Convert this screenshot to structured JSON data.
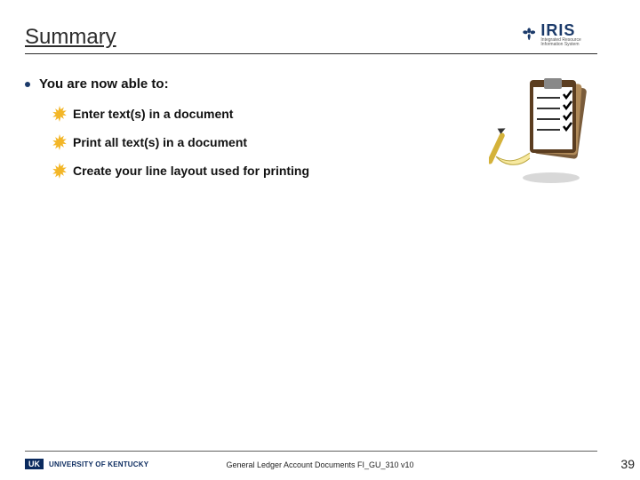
{
  "header": {
    "title": "Summary",
    "logo": {
      "brand": "IRIS",
      "subtitle": "Integrated Resource Information System",
      "icon": "iris-flower-icon"
    }
  },
  "content": {
    "lead": "You are now able to:",
    "items": [
      "Enter text(s) in a document",
      "Print all text(s) in a document",
      "Create your line layout used for printing"
    ]
  },
  "decor": {
    "clipart": "clipboard-checklist-icon"
  },
  "footer": {
    "org_badge": "UK",
    "org_name": "UNIVERSITY OF KENTUCKY",
    "doc_title": "General Ledger Account Documents FI_GU_310 v10",
    "page": "39"
  }
}
